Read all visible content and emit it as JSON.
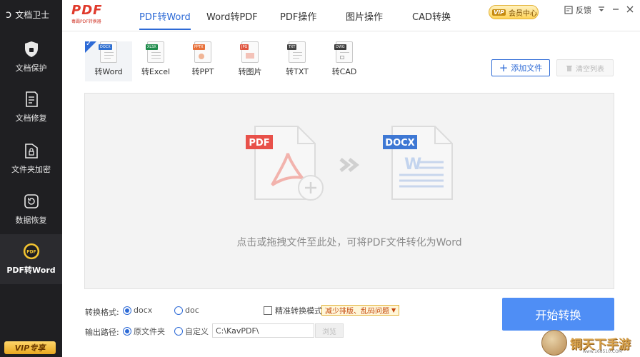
{
  "app": {
    "title": "文档卫士"
  },
  "sidebar": {
    "items": [
      {
        "label": "文档保护",
        "icon": "shield-icon"
      },
      {
        "label": "文档修复",
        "icon": "document-repair-icon"
      },
      {
        "label": "文件夹加密",
        "icon": "folder-lock-icon"
      },
      {
        "label": "数据恢复",
        "icon": "restore-icon"
      },
      {
        "label": "PDF转Word",
        "icon": "pdf-badge-icon",
        "active": true
      }
    ],
    "vip_label": "VIP专享"
  },
  "brand": {
    "name": "PDF",
    "subtitle": "毒霸PDF转换器"
  },
  "tabs": [
    {
      "label": "PDF转Word",
      "active": true
    },
    {
      "label": "Word转PDF"
    },
    {
      "label": "PDF操作"
    },
    {
      "label": "图片操作"
    },
    {
      "label": "CAD转换"
    }
  ],
  "header": {
    "vip_tag": "VIP",
    "vip_center": "会员中心",
    "feedback": "反馈"
  },
  "formats": [
    {
      "label": "转Word",
      "tag": "DOCX",
      "color": "#2f6fd0",
      "active": true
    },
    {
      "label": "转Excel",
      "tag": "XLSX",
      "color": "#1f8c4c"
    },
    {
      "label": "转PPT",
      "tag": "PPTX",
      "color": "#e8713b"
    },
    {
      "label": "转图片",
      "tag": "JPG",
      "color": "#e0553f"
    },
    {
      "label": "转TXT",
      "tag": "TXT",
      "color": "#444444"
    },
    {
      "label": "转CAD",
      "tag": "DWG",
      "color": "#3a3a3a"
    }
  ],
  "actions": {
    "add_file": "添加文件",
    "clear_list": "清空列表"
  },
  "dropzone": {
    "source_tag": "PDF",
    "target_tag": "DOCX",
    "hint": "点击或拖拽文件至此处，可将PDF文件转化为Word"
  },
  "options": {
    "format_label": "转换格式:",
    "format_choices": [
      {
        "label": "docx",
        "selected": true
      },
      {
        "label": "doc",
        "selected": false
      }
    ],
    "precise_label": "精准转换模式",
    "precise_tip": "减少排版、乱码问题",
    "output_label": "输出路径:",
    "output_choices": [
      {
        "label": "原文件夹",
        "selected": true
      },
      {
        "label": "自定义",
        "selected": false
      }
    ],
    "output_path": "C:\\KavPDF\\",
    "browse_label": "浏览",
    "start_label": "开始转换"
  },
  "watermark": {
    "text": "铜天下手游",
    "url": "www.168510.COM"
  },
  "colors": {
    "accent": "#2d6ad6",
    "start_button": "#4f8ef5",
    "brand_red": "#e03a2c",
    "sidebar_bg": "#1f1f22"
  }
}
